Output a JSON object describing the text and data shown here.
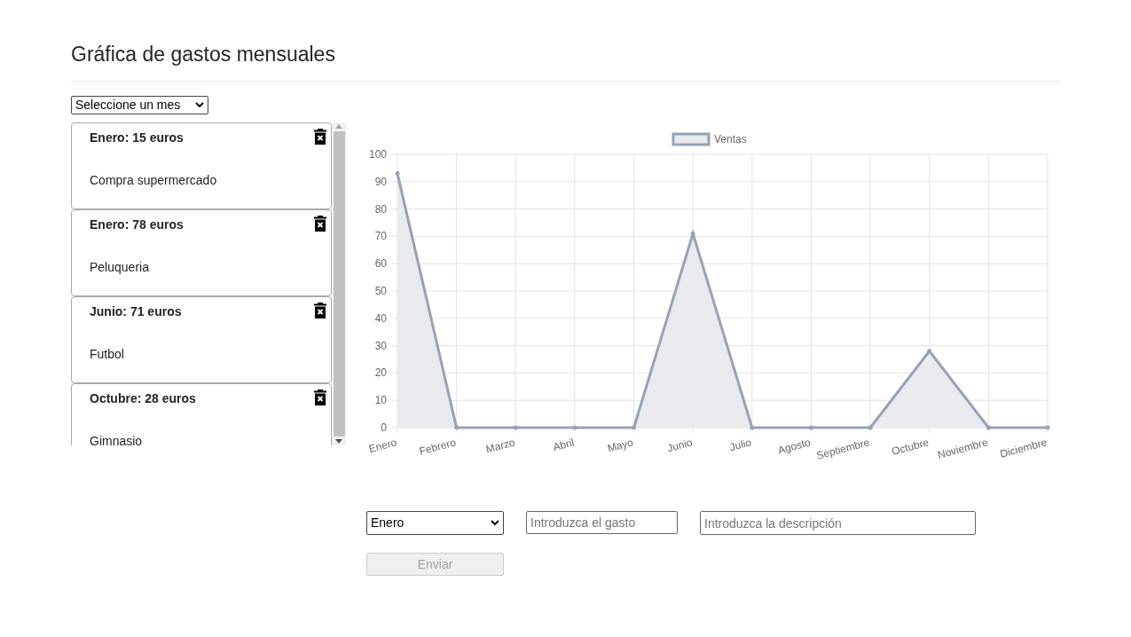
{
  "title": "Gráfica de gastos mensuales",
  "filter": {
    "value": "Seleccione un mes"
  },
  "expenses": [
    {
      "heading": "Enero: 15 euros",
      "description": "Compra supermercado"
    },
    {
      "heading": "Enero: 78 euros",
      "description": "Peluqueria"
    },
    {
      "heading": "Junio: 71 euros",
      "description": "Futbol"
    },
    {
      "heading": "Octubre: 28 euros",
      "description": "Gimnasio"
    }
  ],
  "chart": {
    "chart_data": {
      "type": "area",
      "categories": [
        "Enero",
        "Febrero",
        "Marzo",
        "Abril",
        "Mayo",
        "Junio",
        "Julio",
        "Agosto",
        "Septiembre",
        "Octubre",
        "Noviembre",
        "Diciembre"
      ],
      "series": [
        {
          "name": "Ventas",
          "color": "#97a2b6",
          "values": [
            93,
            0,
            0,
            0,
            0,
            71,
            0,
            0,
            0,
            28,
            0,
            0
          ]
        }
      ],
      "ylim": [
        0,
        100
      ],
      "grid": true,
      "yticks": [
        0,
        10,
        20,
        30,
        40,
        50,
        60,
        70,
        80,
        90,
        100
      ]
    }
  },
  "form": {
    "month": {
      "value": "Enero"
    },
    "amount": {
      "placeholder": "Introduzca el gasto"
    },
    "description": {
      "placeholder": "Introduzca la descripción"
    },
    "submit": {
      "label": "Enviar",
      "disabled": true
    }
  }
}
